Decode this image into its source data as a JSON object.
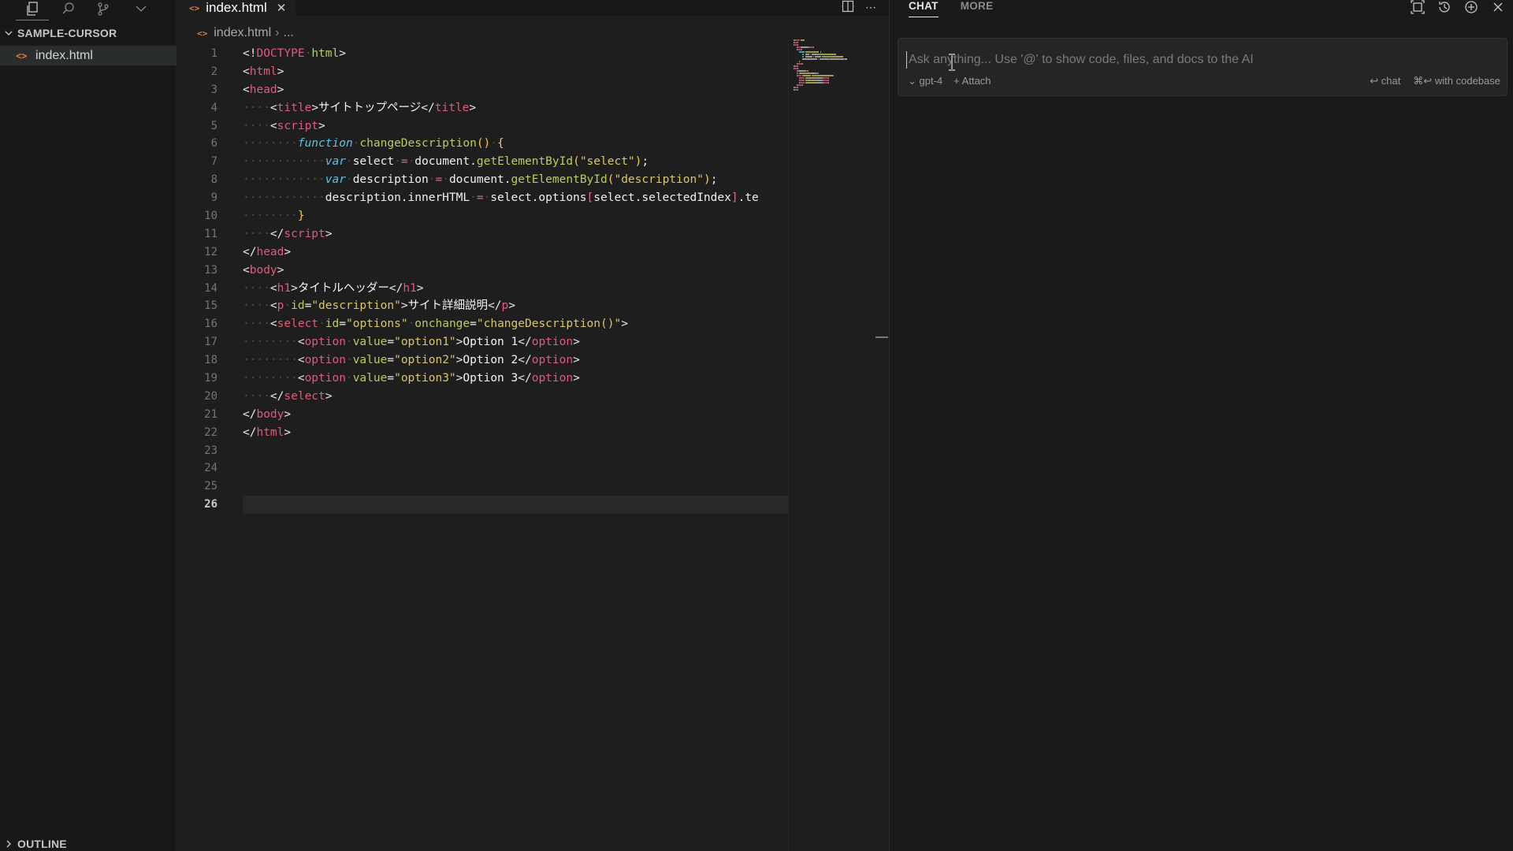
{
  "explorer": {
    "project_name": "SAMPLE-CURSOR",
    "files": [
      "index.html"
    ],
    "outline_label": "OUTLINE"
  },
  "editor": {
    "tab_label": "index.html",
    "breadcrumb": [
      "index.html",
      "..."
    ],
    "current_line": 26,
    "lines": [
      {
        "n": "1",
        "tokens": [
          [
            "t-br",
            "<!"
          ],
          [
            "t-tag",
            "DOCTYPE"
          ],
          [
            "ws",
            "·"
          ],
          [
            "t-attr",
            "html"
          ],
          [
            "t-br",
            ">"
          ]
        ]
      },
      {
        "n": "2",
        "tokens": [
          [
            "t-br",
            "<"
          ],
          [
            "t-tag",
            "html"
          ],
          [
            "t-br",
            ">"
          ]
        ]
      },
      {
        "n": "3",
        "tokens": [
          [
            "t-br",
            "<"
          ],
          [
            "t-tag",
            "head"
          ],
          [
            "t-br",
            ">"
          ]
        ]
      },
      {
        "n": "4",
        "tokens": [
          [
            "ws",
            "····"
          ],
          [
            "t-br",
            "<"
          ],
          [
            "t-tag",
            "title"
          ],
          [
            "t-br",
            ">"
          ],
          [
            "t-text",
            "サイトトップページ"
          ],
          [
            "t-br",
            "</"
          ],
          [
            "t-tag",
            "title"
          ],
          [
            "t-br",
            ">"
          ]
        ]
      },
      {
        "n": "5",
        "tokens": [
          [
            "ws",
            "····"
          ],
          [
            "t-br",
            "<"
          ],
          [
            "t-tag",
            "script"
          ],
          [
            "t-br",
            ">"
          ]
        ]
      },
      {
        "n": "6",
        "tokens": [
          [
            "ws",
            "········"
          ],
          [
            "t-kw",
            "function"
          ],
          [
            "ws",
            "·"
          ],
          [
            "t-fn",
            "changeDescription"
          ],
          [
            "t-punc",
            "()"
          ],
          [
            "ws",
            "·"
          ],
          [
            "t-punc",
            "{"
          ]
        ]
      },
      {
        "n": "7",
        "tokens": [
          [
            "ws",
            "············"
          ],
          [
            "t-kw",
            "var"
          ],
          [
            "ws",
            "·"
          ],
          [
            "t-id",
            "select"
          ],
          [
            "ws",
            "·"
          ],
          [
            "t-op",
            "="
          ],
          [
            "ws",
            "·"
          ],
          [
            "t-id",
            "document."
          ],
          [
            "t-fn",
            "getElementById"
          ],
          [
            "t-punc",
            "("
          ],
          [
            "t-str",
            "\"select\""
          ],
          [
            "t-punc",
            ")"
          ],
          [
            "t-id",
            ";"
          ]
        ]
      },
      {
        "n": "8",
        "tokens": [
          [
            "ws",
            "············"
          ],
          [
            "t-kw",
            "var"
          ],
          [
            "ws",
            "·"
          ],
          [
            "t-id",
            "description"
          ],
          [
            "ws",
            "·"
          ],
          [
            "t-op",
            "="
          ],
          [
            "ws",
            "·"
          ],
          [
            "t-id",
            "document."
          ],
          [
            "t-fn",
            "getElementById"
          ],
          [
            "t-punc",
            "("
          ],
          [
            "t-str",
            "\"description\""
          ],
          [
            "t-punc",
            ")"
          ],
          [
            "t-id",
            ";"
          ]
        ]
      },
      {
        "n": "9",
        "tokens": [
          [
            "ws",
            "············"
          ],
          [
            "t-id",
            "description.innerHTML"
          ],
          [
            "ws",
            "·"
          ],
          [
            "t-op",
            "="
          ],
          [
            "ws",
            "·"
          ],
          [
            "t-id",
            "select.options"
          ],
          [
            "t-op",
            "["
          ],
          [
            "t-id",
            "select.selectedIndex"
          ],
          [
            "t-op",
            "]"
          ],
          [
            "t-id",
            ".te"
          ]
        ]
      },
      {
        "n": "10",
        "tokens": [
          [
            "ws",
            "········"
          ],
          [
            "t-punc",
            "}"
          ]
        ]
      },
      {
        "n": "11",
        "tokens": [
          [
            "ws",
            "····"
          ],
          [
            "t-br",
            "</"
          ],
          [
            "t-tag",
            "script"
          ],
          [
            "t-br",
            ">"
          ]
        ]
      },
      {
        "n": "12",
        "tokens": [
          [
            "t-br",
            "</"
          ],
          [
            "t-tag",
            "head"
          ],
          [
            "t-br",
            ">"
          ]
        ]
      },
      {
        "n": "13",
        "tokens": [
          [
            "t-br",
            "<"
          ],
          [
            "t-tag",
            "body"
          ],
          [
            "t-br",
            ">"
          ]
        ]
      },
      {
        "n": "14",
        "tokens": [
          [
            "ws",
            "····"
          ],
          [
            "t-br",
            "<"
          ],
          [
            "t-tag",
            "h1"
          ],
          [
            "t-br",
            ">"
          ],
          [
            "t-text",
            "タイトルヘッダー"
          ],
          [
            "t-br",
            "</"
          ],
          [
            "t-tag",
            "h1"
          ],
          [
            "t-br",
            ">"
          ]
        ]
      },
      {
        "n": "15",
        "tokens": [
          [
            "ws",
            "····"
          ],
          [
            "t-br",
            "<"
          ],
          [
            "t-tag",
            "p"
          ],
          [
            "ws",
            "·"
          ],
          [
            "t-attr",
            "id"
          ],
          [
            "t-id",
            "="
          ],
          [
            "t-str",
            "\"description\""
          ],
          [
            "t-br",
            ">"
          ],
          [
            "t-text",
            "サイト詳細説明"
          ],
          [
            "t-br",
            "</"
          ],
          [
            "t-tag",
            "p"
          ],
          [
            "t-br",
            ">"
          ]
        ]
      },
      {
        "n": "16",
        "tokens": [
          [
            "ws",
            "····"
          ],
          [
            "t-br",
            "<"
          ],
          [
            "t-tag",
            "select"
          ],
          [
            "ws",
            "·"
          ],
          [
            "t-attr",
            "id"
          ],
          [
            "t-id",
            "="
          ],
          [
            "t-str",
            "\"options\""
          ],
          [
            "ws",
            "·"
          ],
          [
            "t-attr",
            "onchange"
          ],
          [
            "t-id",
            "="
          ],
          [
            "t-str",
            "\"changeDescription()\""
          ],
          [
            "t-br",
            ">"
          ]
        ]
      },
      {
        "n": "17",
        "tokens": [
          [
            "ws",
            "········"
          ],
          [
            "t-br",
            "<"
          ],
          [
            "t-tag",
            "option"
          ],
          [
            "ws",
            "·"
          ],
          [
            "t-attr",
            "value"
          ],
          [
            "t-id",
            "="
          ],
          [
            "t-str",
            "\"option1\""
          ],
          [
            "t-br",
            ">"
          ],
          [
            "t-text",
            "Option 1"
          ],
          [
            "t-br",
            "</"
          ],
          [
            "t-tag",
            "option"
          ],
          [
            "t-br",
            ">"
          ]
        ]
      },
      {
        "n": "18",
        "tokens": [
          [
            "ws",
            "········"
          ],
          [
            "t-br",
            "<"
          ],
          [
            "t-tag",
            "option"
          ],
          [
            "ws",
            "·"
          ],
          [
            "t-attr",
            "value"
          ],
          [
            "t-id",
            "="
          ],
          [
            "t-str",
            "\"option2\""
          ],
          [
            "t-br",
            ">"
          ],
          [
            "t-text",
            "Option 2"
          ],
          [
            "t-br",
            "</"
          ],
          [
            "t-tag",
            "option"
          ],
          [
            "t-br",
            ">"
          ]
        ]
      },
      {
        "n": "19",
        "tokens": [
          [
            "ws",
            "········"
          ],
          [
            "t-br",
            "<"
          ],
          [
            "t-tag",
            "option"
          ],
          [
            "ws",
            "·"
          ],
          [
            "t-attr",
            "value"
          ],
          [
            "t-id",
            "="
          ],
          [
            "t-str",
            "\"option3\""
          ],
          [
            "t-br",
            ">"
          ],
          [
            "t-text",
            "Option 3"
          ],
          [
            "t-br",
            "</"
          ],
          [
            "t-tag",
            "option"
          ],
          [
            "t-br",
            ">"
          ]
        ]
      },
      {
        "n": "20",
        "tokens": [
          [
            "ws",
            "····"
          ],
          [
            "t-br",
            "</"
          ],
          [
            "t-tag",
            "select"
          ],
          [
            "t-br",
            ">"
          ]
        ]
      },
      {
        "n": "21",
        "tokens": [
          [
            "t-br",
            "</"
          ],
          [
            "t-tag",
            "body"
          ],
          [
            "t-br",
            ">"
          ]
        ]
      },
      {
        "n": "22",
        "tokens": [
          [
            "t-br",
            "</"
          ],
          [
            "t-tag",
            "html"
          ],
          [
            "t-br",
            ">"
          ]
        ]
      },
      {
        "n": "23",
        "tokens": []
      },
      {
        "n": "24",
        "tokens": []
      },
      {
        "n": "25",
        "tokens": []
      },
      {
        "n": "26",
        "tokens": []
      }
    ]
  },
  "chat": {
    "tabs": [
      "CHAT",
      "MORE"
    ],
    "active_tab": "CHAT",
    "input_placeholder": "Ask anything... Use '@' to show code, files, and docs to the AI",
    "model_label": "gpt-4",
    "attach_label": "Attach",
    "chat_hint": "chat",
    "codebase_hint": "with codebase"
  },
  "colors": {
    "background": "#1e1e1e",
    "sidebar": "#181818",
    "chat_panel": "#1a1a1a",
    "tag": "#e05a7a",
    "attribute": "#b5cf5f",
    "string": "#d9c66b",
    "keyword": "#5fc0e0",
    "file_icon": "#e37933"
  }
}
